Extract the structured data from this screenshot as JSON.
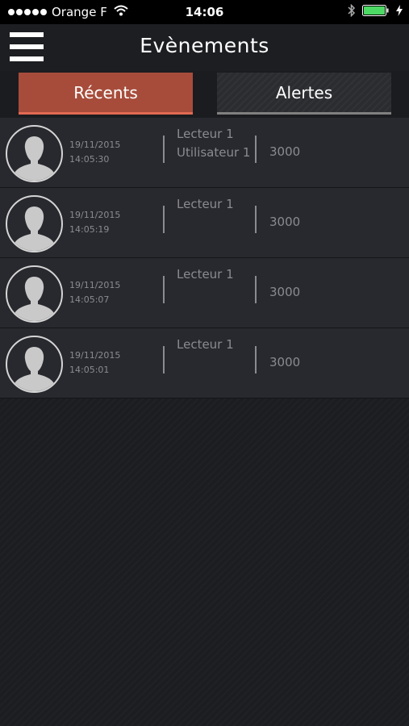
{
  "status_bar": {
    "carrier": "Orange F",
    "time": "14:06"
  },
  "nav": {
    "title": "Evènements"
  },
  "tabs": [
    {
      "label": "Récents",
      "active": true
    },
    {
      "label": "Alertes",
      "active": false
    }
  ],
  "events": [
    {
      "date": "19/11/2015",
      "time": "14:05:30",
      "reader": "Lecteur 1",
      "user": "Utilisateur 1",
      "code": "3000"
    },
    {
      "date": "19/11/2015",
      "time": "14:05:19",
      "reader": "Lecteur 1",
      "user": "",
      "code": "3000"
    },
    {
      "date": "19/11/2015",
      "time": "14:05:07",
      "reader": "Lecteur 1",
      "user": "",
      "code": "3000"
    },
    {
      "date": "19/11/2015",
      "time": "14:05:01",
      "reader": "Lecteur 1",
      "user": "",
      "code": "3000"
    }
  ],
  "colors": {
    "accent": "#a74c3b",
    "background": "#1c1d21",
    "row": "#28292e",
    "muted_text": "#8a8b90"
  },
  "icons": {
    "menu": "hamburger-menu-icon",
    "avatar": "user-silhouette-icon",
    "wifi": "wifi-icon",
    "bluetooth": "bluetooth-icon",
    "battery": "battery-icon"
  }
}
